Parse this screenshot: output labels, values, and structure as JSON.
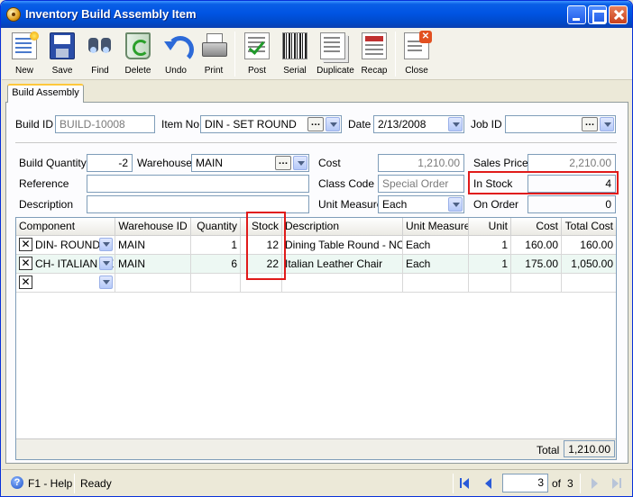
{
  "window": {
    "title": "Inventory Build Assembly Item"
  },
  "toolbar": {
    "new": "New",
    "save": "Save",
    "find": "Find",
    "delete": "Delete",
    "undo": "Undo",
    "print": "Print",
    "post": "Post",
    "serial": "Serial",
    "duplicate": "Duplicate",
    "recap": "Recap",
    "close": "Close"
  },
  "tab": {
    "label": "Build Assembly"
  },
  "form": {
    "build_id_label": "Build ID",
    "build_id": "BUILD-10008",
    "item_no_label": "Item No",
    "item_no": "DIN - SET ROUND",
    "date_label": "Date",
    "date": "2/13/2008",
    "job_id_label": "Job ID",
    "job_id": "",
    "build_quantity_label": "Build Quantity",
    "build_quantity": "-2",
    "warehouse_label": "Warehouse",
    "warehouse": "MAIN",
    "cost_label": "Cost",
    "cost": "1,210.00",
    "sales_price_label": "Sales Price",
    "sales_price": "2,210.00",
    "reference_label": "Reference",
    "reference": "",
    "class_code_label": "Class Code",
    "class_code": "Special Order",
    "in_stock_label": "In Stock",
    "in_stock": "4",
    "description_label": "Description",
    "description": "",
    "unit_measure_label": "Unit Measure",
    "unit_measure": "Each",
    "on_order_label": "On Order",
    "on_order": "0"
  },
  "grid": {
    "columns": [
      "Component",
      "Warehouse ID",
      "Quantity",
      "Stock",
      "Description",
      "Unit Measure",
      "Unit",
      "Cost",
      "Total Cost"
    ],
    "rows": [
      {
        "component": "DIN- ROUND",
        "warehouse_id": "MAIN",
        "quantity": "1",
        "stock": "12",
        "description": "Dining Table Round - NORD",
        "unit_measure": "Each",
        "unit": "1",
        "cost": "160.00",
        "total_cost": "160.00"
      },
      {
        "component": "CH- ITALIAN LE",
        "warehouse_id": "MAIN",
        "quantity": "6",
        "stock": "22",
        "description": "Italian Leather Chair",
        "unit_measure": "Each",
        "unit": "1",
        "cost": "175.00",
        "total_cost": "1,050.00"
      }
    ],
    "total_label": "Total",
    "total": "1,210.00"
  },
  "status": {
    "help": "F1 - Help",
    "state": "Ready",
    "page": "3",
    "of_label": "of",
    "page_count": "3"
  },
  "colors": {
    "title_bar": "#0054e3",
    "highlight_box": "#e01a1a",
    "alt_row": "#edf8f3"
  }
}
